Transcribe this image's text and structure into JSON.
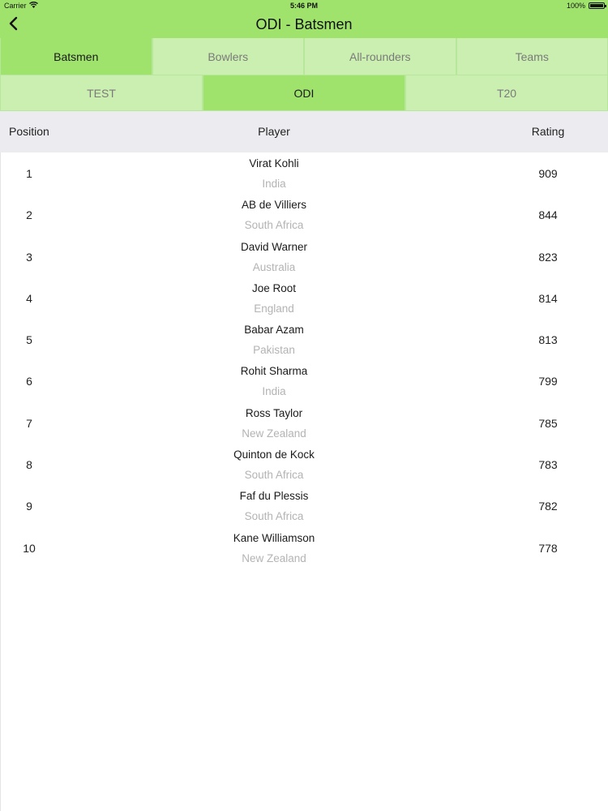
{
  "status_bar": {
    "carrier": "Carrier",
    "time": "5:46 PM",
    "battery": "100%",
    "battery_level": 1.0
  },
  "nav": {
    "title": "ODI - Batsmen",
    "back_icon": "chevron-left-icon"
  },
  "category_tabs": [
    {
      "label": "Batsmen",
      "active": true
    },
    {
      "label": "Bowlers",
      "active": false
    },
    {
      "label": "All-rounders",
      "active": false
    },
    {
      "label": "Teams",
      "active": false
    }
  ],
  "format_tabs": [
    {
      "label": "TEST",
      "active": false
    },
    {
      "label": "ODI",
      "active": true
    },
    {
      "label": "T20",
      "active": false
    }
  ],
  "table": {
    "headers": {
      "position": "Position",
      "player": "Player",
      "rating": "Rating"
    },
    "rows": [
      {
        "position": "1",
        "name": "Virat Kohli",
        "country": "India",
        "rating": "909"
      },
      {
        "position": "2",
        "name": "AB de Villiers",
        "country": "South Africa",
        "rating": "844"
      },
      {
        "position": "3",
        "name": "David Warner",
        "country": "Australia",
        "rating": "823"
      },
      {
        "position": "4",
        "name": "Joe Root",
        "country": "England",
        "rating": "814"
      },
      {
        "position": "5",
        "name": "Babar Azam",
        "country": "Pakistan",
        "rating": "813"
      },
      {
        "position": "6",
        "name": "Rohit Sharma",
        "country": "India",
        "rating": "799"
      },
      {
        "position": "7",
        "name": "Ross Taylor",
        "country": "New Zealand",
        "rating": "785"
      },
      {
        "position": "8",
        "name": "Quinton de Kock",
        "country": "South Africa",
        "rating": "783"
      },
      {
        "position": "9",
        "name": "Faf du Plessis",
        "country": "South Africa",
        "rating": "782"
      },
      {
        "position": "10",
        "name": "Kane Williamson",
        "country": "New Zealand",
        "rating": "778"
      }
    ]
  },
  "colors": {
    "header_green": "#9fe36d",
    "tab_light_green": "#cbefb0",
    "table_header_gray": "#ececf0",
    "country_gray": "#b3b3b3"
  }
}
